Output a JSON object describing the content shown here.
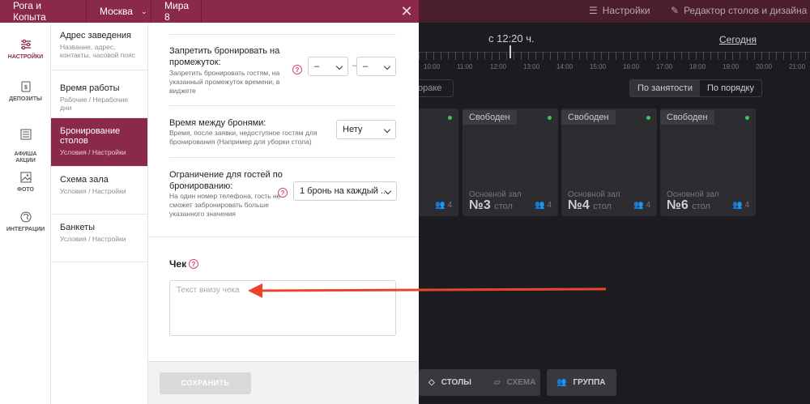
{
  "topbar": {
    "brand": "Рога и Копыта",
    "city": "Москва",
    "address": "Мира 8"
  },
  "background": {
    "settings_label": "Настройки",
    "editor_label": "Редактор столов и дизайна",
    "time_prefix": "с 12:20 ч.",
    "today_label": "Сегодня",
    "time_ticks": [
      "10:00",
      "11:00",
      "12:00",
      "13:00",
      "14:00",
      "15:00",
      "16:00",
      "17:00",
      "18:00",
      "19:00",
      "20:00",
      "21:00"
    ],
    "left_btn": "ораке",
    "tabs": [
      "По занятости",
      "По порядку"
    ],
    "cards": [
      {
        "status": "",
        "hall": "",
        "number": "",
        "unit": "",
        "cap": "4"
      },
      {
        "status": "Свободен",
        "hall": "Основной зал",
        "number": "№3",
        "unit": "стол",
        "cap": "4"
      },
      {
        "status": "Свободен",
        "hall": "Основной зал",
        "number": "№4",
        "unit": "стол",
        "cap": "4"
      },
      {
        "status": "Свободен",
        "hall": "Основной зал",
        "number": "№6",
        "unit": "стол",
        "cap": "4"
      }
    ],
    "bottom": {
      "tables": "СТОЛЫ",
      "scheme": "СХЕМА",
      "group": "ГРУППА"
    }
  },
  "sidebar": {
    "items": [
      {
        "label": "НАСТРОЙКИ"
      },
      {
        "label": "ДЕПОЗИТЫ"
      },
      {
        "label": "АФИША\nАКЦИИ"
      },
      {
        "label": "ФОТО"
      },
      {
        "label": "ИНТЕГРАЦИИ"
      }
    ]
  },
  "subnav": {
    "items": [
      {
        "title": "Адрес заведения",
        "desc": "Название, адрес, контакты, часовой пояс"
      },
      {
        "title": "Время работы",
        "desc": "Рабочие / Нерабочие дни"
      },
      {
        "title": "Бронирование столов",
        "desc": "Условия / Настройки"
      },
      {
        "title": "Схема зала",
        "desc": "Условия / Настройки"
      },
      {
        "title": "Банкеты",
        "desc": "Условия / Настройки"
      }
    ]
  },
  "content": {
    "forbid": {
      "title": "Запретить бронировать на промежуток:",
      "desc": "Запретить бронировать гостям, на указанный промежуток времени, в виджете",
      "from": "–",
      "to": "–",
      "dash": "–"
    },
    "between": {
      "title": "Время между бронями:",
      "desc": "Время, после заявки, недоступное гостям для бронирования (Например для уборки стола)",
      "value": "Нету"
    },
    "limit": {
      "title": "Ограничение для гостей по бронированию:",
      "desc": "На один номер телефона, гость не сможет забронировать больше указанного значения",
      "value": "1 бронь на каждый ..."
    },
    "check": {
      "title": "Чек",
      "placeholder": "Текст внизу чека"
    },
    "help": "?",
    "save": "СОХРАНИТЬ"
  },
  "colors": {
    "accent": "#8a2a48",
    "arrow": "#e8452c"
  }
}
